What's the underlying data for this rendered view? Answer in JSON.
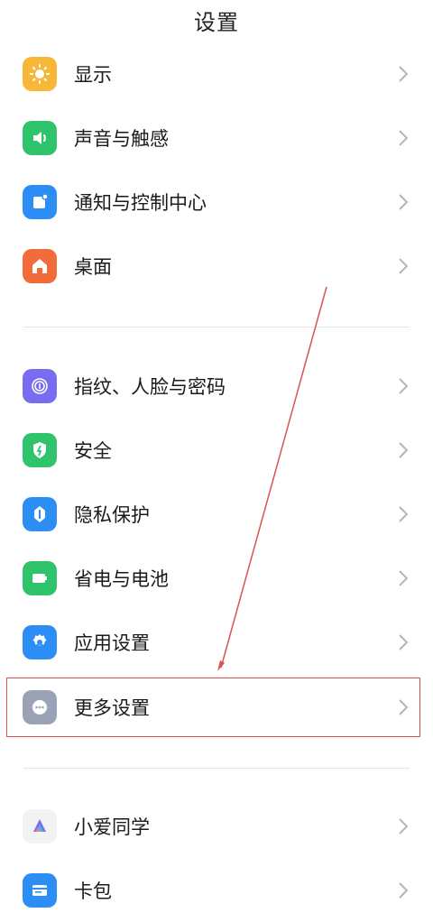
{
  "header": {
    "title": "设置"
  },
  "group1": [
    {
      "label": "显示",
      "icon": "brightness-icon",
      "color": "#F7B83A"
    },
    {
      "label": "声音与触感",
      "icon": "speaker-icon",
      "color": "#2FC36C"
    },
    {
      "label": "通知与控制中心",
      "icon": "notification-icon",
      "color": "#2C8DF4"
    },
    {
      "label": "桌面",
      "icon": "home-icon",
      "color": "#F26B3A"
    }
  ],
  "group2": [
    {
      "label": "指纹、人脸与密码",
      "icon": "fingerprint-icon",
      "color": "#7A6CF0"
    },
    {
      "label": "安全",
      "icon": "shield-icon",
      "color": "#2FC36C"
    },
    {
      "label": "隐私保护",
      "icon": "privacy-icon",
      "color": "#2C8DF4"
    },
    {
      "label": "省电与电池",
      "icon": "battery-icon",
      "color": "#2FC36C"
    },
    {
      "label": "应用设置",
      "icon": "gear-icon",
      "color": "#2C8DF4"
    },
    {
      "label": "更多设置",
      "icon": "more-icon",
      "color": "#9AA3B5"
    }
  ],
  "group3": [
    {
      "label": "小爱同学",
      "icon": "xiaoai-icon",
      "color": "#F2F2F2"
    },
    {
      "label": "卡包",
      "icon": "wallet-icon",
      "color": "#2C8DF4"
    }
  ],
  "annotation": {
    "highlight_color": "#D9534F"
  }
}
